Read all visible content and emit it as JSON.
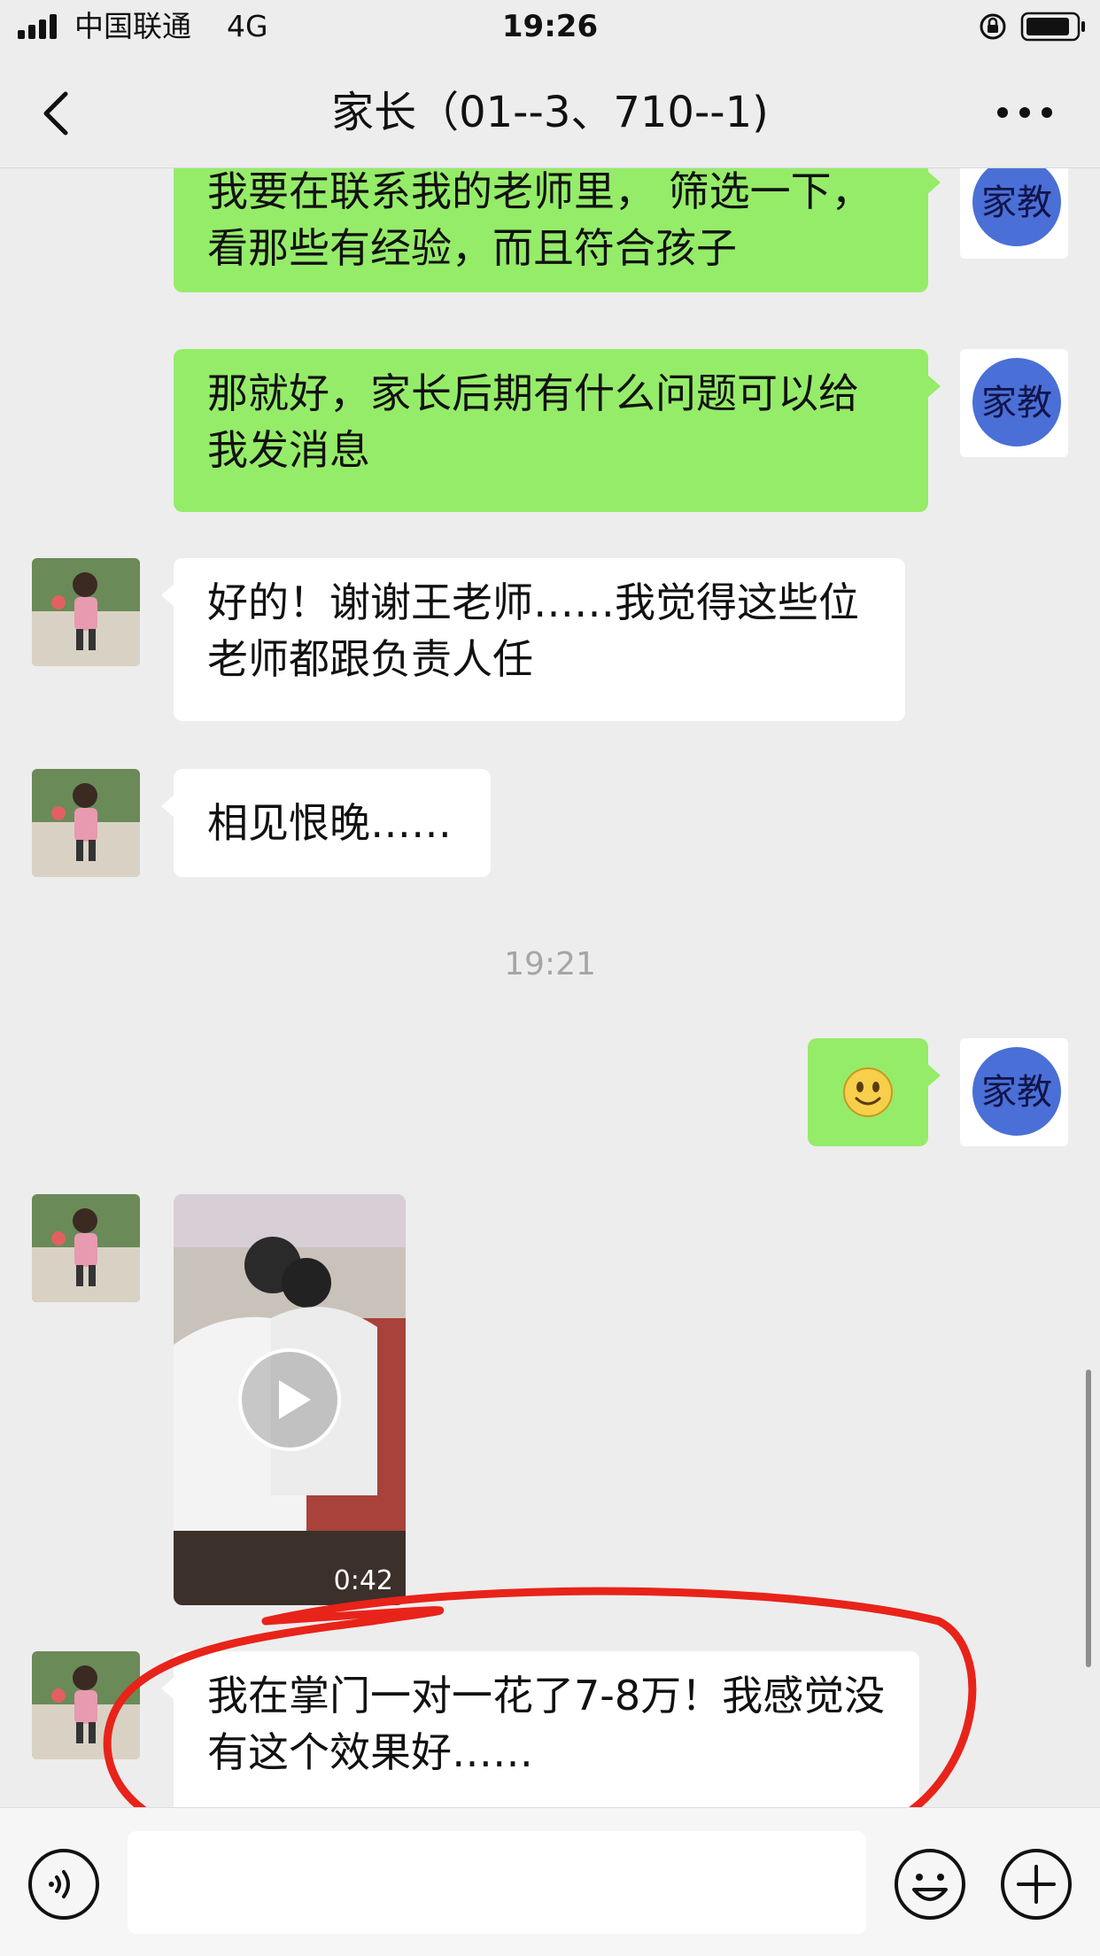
{
  "status_bar": {
    "carrier": "中国联通",
    "network": "4G",
    "time": "19:26"
  },
  "nav": {
    "title": "家长（01--3、710--1)",
    "back_icon": "chevron-left-icon",
    "more_icon": "more-dots-icon"
  },
  "avatars": {
    "self_label": "家教",
    "contact": "child-photo"
  },
  "messages": [
    {
      "sender": "self",
      "text": "我要在联系我的老师里， 筛选一下，看那些有经验，而且符合孩子"
    },
    {
      "sender": "self",
      "text": "那就好，家长后期有什么问题可以给我发消息"
    },
    {
      "sender": "contact",
      "text": "好的！谢谢王老师……我觉得这些位老师都跟负责人任"
    },
    {
      "sender": "contact",
      "text": "相见恨晚……"
    },
    {
      "type": "timestamp",
      "text": "19:21"
    },
    {
      "sender": "self",
      "type": "emoji",
      "emoji": "smile"
    },
    {
      "sender": "contact",
      "type": "video",
      "duration": "0:42"
    },
    {
      "sender": "contact",
      "text": "我在掌门一对一花了7-8万！我感觉没有这个效果好……"
    }
  ],
  "input_bar": {
    "placeholder": "",
    "voice_icon": "voice-icon",
    "emoji_icon": "emoji-icon",
    "plus_icon": "plus-icon"
  },
  "colors": {
    "background": "#ededed",
    "self_bubble": "#95ec69",
    "contact_bubble": "#ffffff",
    "annotation": "#e8231a"
  }
}
